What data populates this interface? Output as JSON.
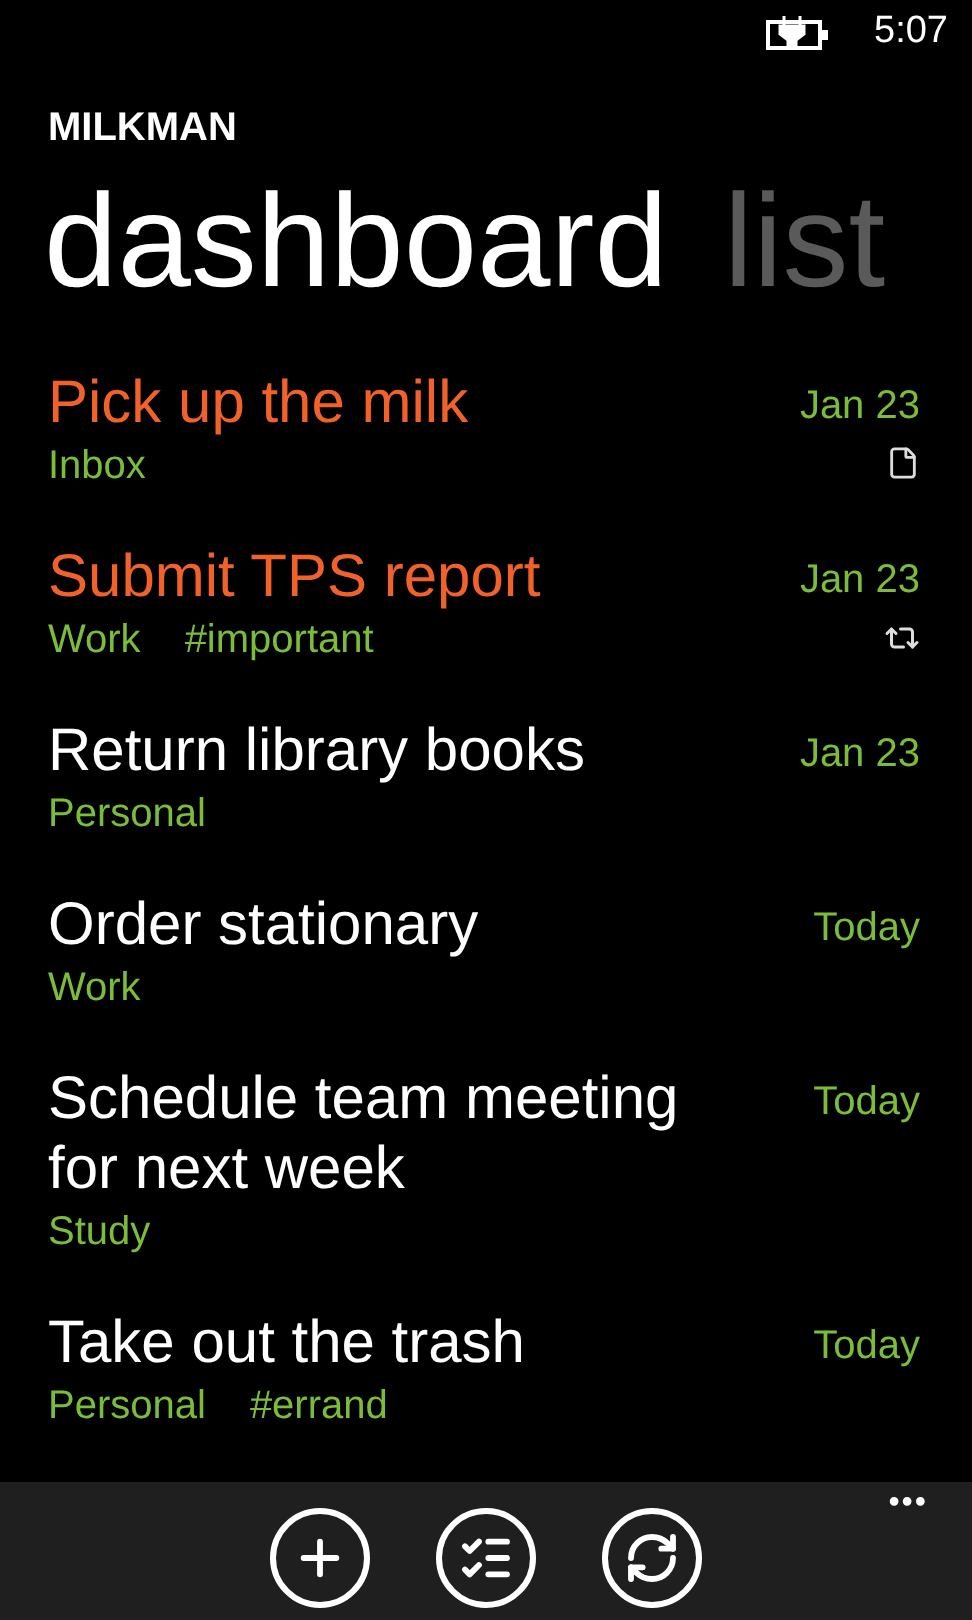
{
  "status_bar": {
    "time": "5:07"
  },
  "app_title": "MILKMAN",
  "pivot": [
    {
      "label": "dashboard",
      "selected": true
    },
    {
      "label": "list",
      "selected": false
    }
  ],
  "tasks": [
    {
      "title": "Pick up the milk",
      "priority": true,
      "tags": [
        "Inbox"
      ],
      "due": "Jan 23",
      "kind": "note"
    },
    {
      "title": "Submit TPS report",
      "priority": true,
      "tags": [
        "Work",
        "#important"
      ],
      "due": "Jan 23",
      "kind": "repeat"
    },
    {
      "title": "Return library books",
      "priority": false,
      "tags": [
        "Personal"
      ],
      "due": "Jan 23"
    },
    {
      "title": "Order stationary",
      "priority": false,
      "tags": [
        "Work"
      ],
      "due": "Today"
    },
    {
      "title": "Schedule team meeting for next week",
      "priority": false,
      "tags": [
        "Study"
      ],
      "due": "Today"
    },
    {
      "title": "Take out the trash",
      "priority": false,
      "tags": [
        "Personal",
        "#errand"
      ],
      "due": "Today"
    }
  ],
  "app_bar": {
    "buttons": [
      {
        "kind": "add"
      },
      {
        "kind": "lists"
      },
      {
        "kind": "sync"
      }
    ],
    "more": "•••"
  }
}
